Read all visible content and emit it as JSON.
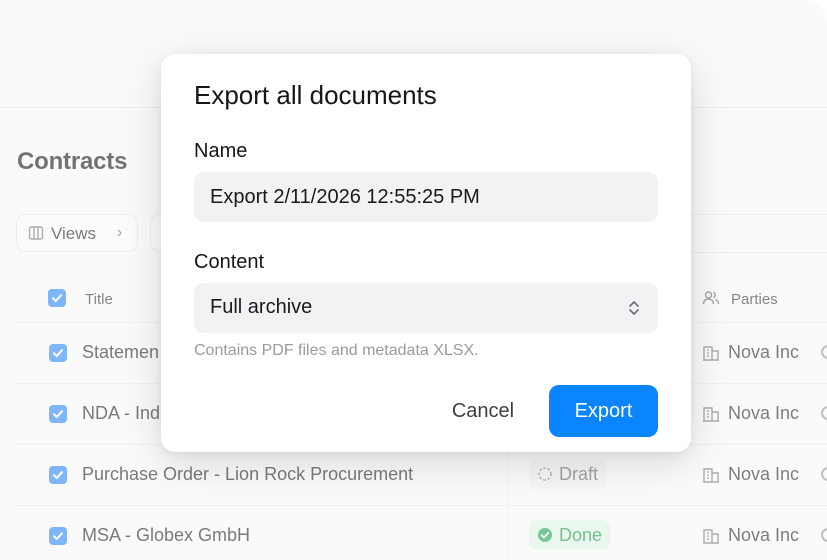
{
  "page": {
    "title": "Contracts"
  },
  "toolbar": {
    "views_label": "Views"
  },
  "table": {
    "columns": {
      "title": "Title",
      "parties": "Parties"
    },
    "rows": [
      {
        "title": "Statemen",
        "status": "",
        "party": "Nova Inc"
      },
      {
        "title": "NDA - Ind",
        "status": "",
        "party": "Nova Inc"
      },
      {
        "title": "Purchase Order - Lion Rock Procurement",
        "status": "Draft",
        "party": "Nova Inc"
      },
      {
        "title": "MSA - Globex GmbH",
        "status": "Done",
        "party": "Nova Inc"
      }
    ]
  },
  "modal": {
    "title": "Export all documents",
    "name_label": "Name",
    "name_value": "Export 2/11/2026 12:55:25 PM",
    "content_label": "Content",
    "content_value": "Full archive",
    "content_help": "Contains PDF files and metadata XLSX.",
    "cancel_label": "Cancel",
    "export_label": "Export"
  },
  "colors": {
    "accent": "#0a84ff",
    "checkbox": "#2f8af5",
    "done_bg": "#dcf3e4",
    "done_text": "#1f9c4e",
    "draft_bg": "#efeff1"
  }
}
